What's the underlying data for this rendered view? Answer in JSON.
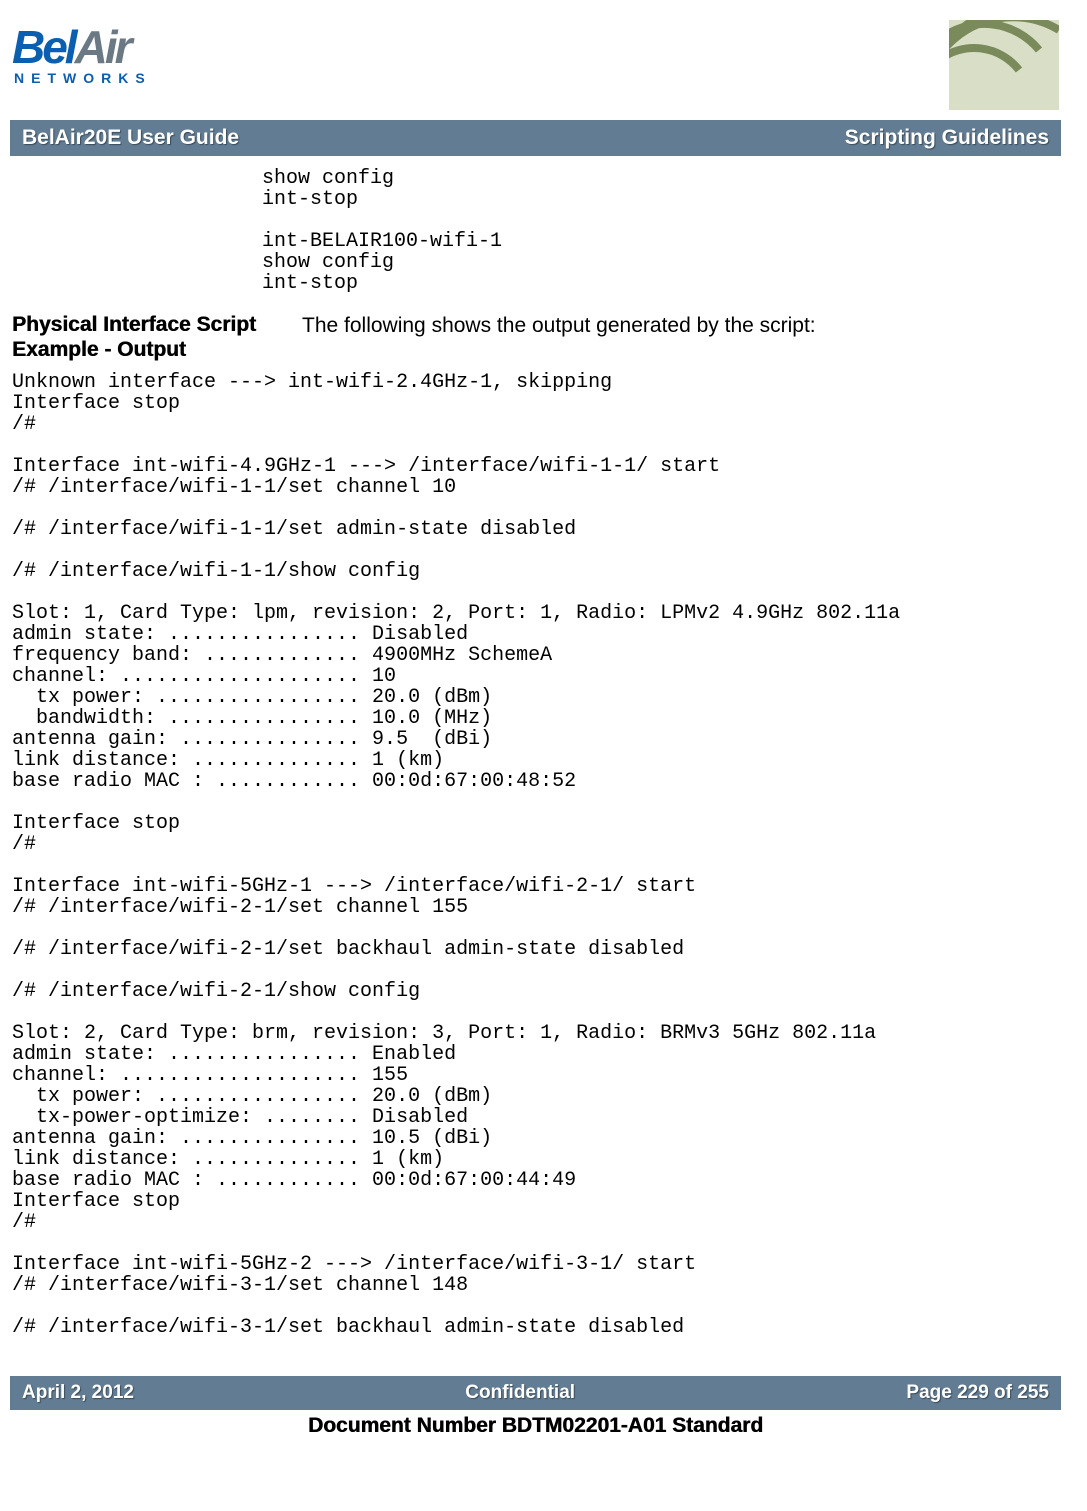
{
  "header": {
    "logo_bel": "Bel",
    "logo_air": "Air",
    "networks": "NETWORKS"
  },
  "titlebar": {
    "left": "BelAir20E User Guide",
    "right": "Scripting Guidelines"
  },
  "top_code": "show config\nint-stop\n\nint-BELAIR100-wifi-1\nshow config\nint-stop",
  "section": {
    "title": "Physical Interface Script Example - Output",
    "desc": "The following shows the output generated by the script:"
  },
  "main_code": "Unknown interface ---> int-wifi-2.4GHz-1, skipping\nInterface stop\n/#\n\nInterface int-wifi-4.9GHz-1 ---> /interface/wifi-1-1/ start\n/# /interface/wifi-1-1/set channel 10\n\n/# /interface/wifi-1-1/set admin-state disabled\n\n/# /interface/wifi-1-1/show config\n\nSlot: 1, Card Type: lpm, revision: 2, Port: 1, Radio: LPMv2 4.9GHz 802.11a\nadmin state: ................ Disabled\nfrequency band: ............. 4900MHz SchemeA\nchannel: .................... 10\n  tx power: ................. 20.0 (dBm)\n  bandwidth: ................ 10.0 (MHz)\nantenna gain: ............... 9.5  (dBi)\nlink distance: .............. 1 (km)\nbase radio MAC : ............ 00:0d:67:00:48:52\n\nInterface stop\n/#\n\nInterface int-wifi-5GHz-1 ---> /interface/wifi-2-1/ start\n/# /interface/wifi-2-1/set channel 155\n\n/# /interface/wifi-2-1/set backhaul admin-state disabled\n\n/# /interface/wifi-2-1/show config\n\nSlot: 2, Card Type: brm, revision: 3, Port: 1, Radio: BRMv3 5GHz 802.11a\nadmin state: ................ Enabled\nchannel: .................... 155\n  tx power: ................. 20.0 (dBm)\n  tx-power-optimize: ........ Disabled\nantenna gain: ............... 10.5 (dBi)\nlink distance: .............. 1 (km)\nbase radio MAC : ............ 00:0d:67:00:44:49\nInterface stop\n/#\n\nInterface int-wifi-5GHz-2 ---> /interface/wifi-3-1/ start\n/# /interface/wifi-3-1/set channel 148\n\n/# /interface/wifi-3-1/set backhaul admin-state disabled",
  "footer": {
    "left": "April 2, 2012",
    "center": "Confidential",
    "right": "Page 229 of 255"
  },
  "doc_number": "Document Number BDTM02201-A01 Standard"
}
